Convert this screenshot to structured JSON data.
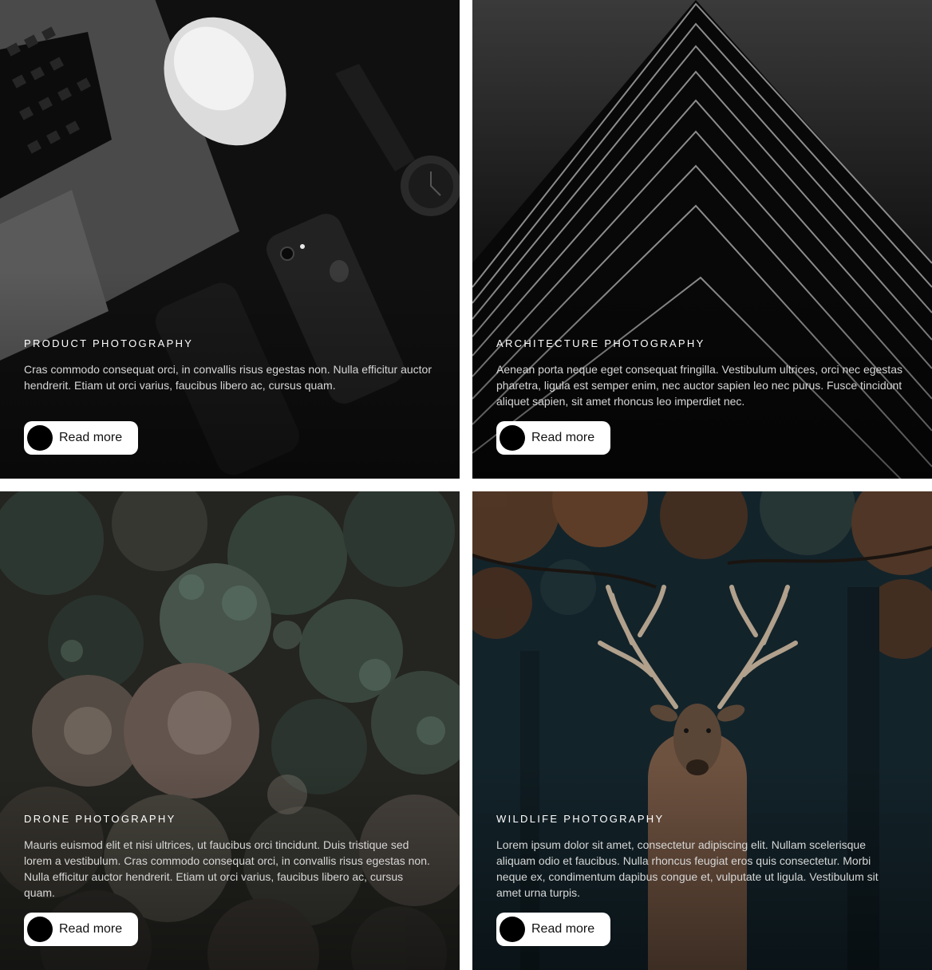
{
  "cards": [
    {
      "title": "PRODUCT PHOTOGRAPHY",
      "description": "Cras commodo consequat orci, in convallis risus egestas non. Nulla efficitur auctor hendrerit. Etiam ut orci varius, faucibus libero ac, cursus quam.",
      "button_label": "Read more",
      "image": "laptop-mouse-watch-phone-photo"
    },
    {
      "title": "ARCHITECTURE PHOTOGRAPHY",
      "description": "Aenean porta neque eget consequat fringilla. Vestibulum ultrices, orci nec egestas pharetra, ligula est semper enim, nec auctor sapien leo nec purus. Fusce tincidunt aliquet sapien, sit amet rhoncus leo imperdiet nec.",
      "button_label": "Read more",
      "image": "building-chevron-photo"
    },
    {
      "title": "DRONE PHOTOGRAPHY",
      "description": "Mauris euismod elit et nisi ultrices, ut faucibus orci tincidunt. Duis tristique sed lorem a vestibulum. Cras commodo consequat orci, in convallis risus egestas non. Nulla efficitur auctor hendrerit. Etiam ut orci varius, faucibus libero ac, cursus quam.",
      "button_label": "Read more",
      "image": "forest-aerial-photo"
    },
    {
      "title": "WILDLIFE PHOTOGRAPHY",
      "description": "Lorem ipsum dolor sit amet, consectetur adipiscing elit. Nullam scelerisque aliquam odio et faucibus. Nulla rhoncus feugiat eros quis consectetur. Morbi neque ex, condimentum dapibus congue et, vulputate ut ligula. Vestibulum sit amet urna turpis.",
      "button_label": "Read more",
      "image": "deer-forest-photo"
    }
  ],
  "colors": {
    "button_bg": "#ffffff",
    "button_dot": "#000000",
    "title": "#ffffff",
    "text": "#d7d7d7"
  }
}
